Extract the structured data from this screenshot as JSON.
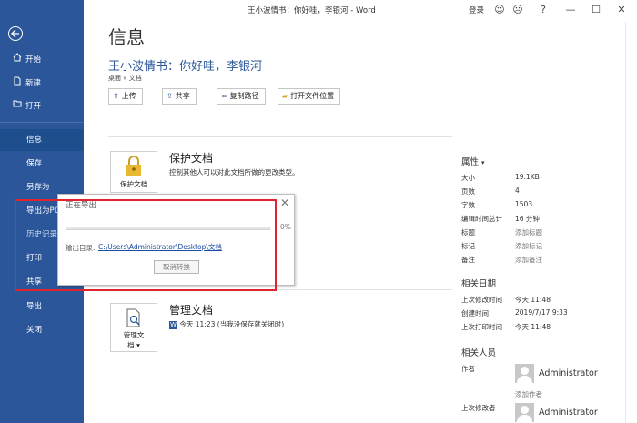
{
  "window": {
    "title": "王小波情书：你好哇，李银河  -  Word",
    "login": "登录",
    "icons": [
      "smile-icon",
      "frown-icon",
      "help-icon",
      "minimize-icon",
      "maximize-icon",
      "close-icon"
    ]
  },
  "sidebar": {
    "items": [
      {
        "label": "开始",
        "icon": "home-icon"
      },
      {
        "label": "新建",
        "icon": "new-doc-icon"
      },
      {
        "label": "打开",
        "icon": "open-folder-icon"
      },
      {
        "label": "信息"
      },
      {
        "label": "保存"
      },
      {
        "label": "另存为"
      },
      {
        "label": "导出为PDF"
      },
      {
        "label": "历史记录"
      },
      {
        "label": "打印"
      },
      {
        "label": "共享"
      },
      {
        "label": "导出"
      },
      {
        "label": "关闭"
      }
    ],
    "active": "信息",
    "accent": "#2b579a"
  },
  "main": {
    "page_title": "信息",
    "doc_heading": "王小波情书：你好哇，李银河",
    "breadcrumb": "桌面 » 文档",
    "buttons": [
      {
        "label": "上传",
        "icon": "upload-icon"
      },
      {
        "label": "共享",
        "icon": "share-icon"
      },
      {
        "label": "复制路径",
        "icon": "link-icon"
      },
      {
        "label": "打开文件位置",
        "icon": "folder-icon"
      }
    ],
    "protect": {
      "title": "保护文档",
      "desc": "控制其他人可以对此文档所做的更改类型。",
      "button_label": "保护文档"
    },
    "manage": {
      "title": "管理文档",
      "desc": "今天 11:23 (当我没保存就关闭时)",
      "button_line1": "管理文",
      "button_line2": "档"
    }
  },
  "properties": {
    "header": "属性",
    "rows": [
      {
        "label": "大小",
        "value": "19.1KB"
      },
      {
        "label": "页数",
        "value": "4"
      },
      {
        "label": "字数",
        "value": "1503"
      },
      {
        "label": "编辑时间总计",
        "value": "16 分钟"
      },
      {
        "label": "标题",
        "value": "添加标题"
      },
      {
        "label": "标记",
        "value": "添加标记"
      },
      {
        "label": "备注",
        "value": "添加备注"
      }
    ],
    "dates_header": "相关日期",
    "dates": [
      {
        "label": "上次修改时间",
        "value": "今天 11:48"
      },
      {
        "label": "创建时间",
        "value": "2019/7/17 9:33"
      },
      {
        "label": "上次打印时间",
        "value": "今天 11:48"
      }
    ],
    "people_header": "相关人员",
    "author_label": "作者",
    "author_name": "Administrator",
    "add_author": "添加作者",
    "last_modified_by_label": "上次修改者",
    "last_modified_by_name": "Administrator"
  },
  "dialog": {
    "title": "正在导出",
    "percent": "0%",
    "progress": 0,
    "output_label": "输出目录:",
    "output_path": "C:\\Users\\Administrator\\Desktop\\文档",
    "cancel": "取消转换",
    "highlight_color": "#e0232c"
  }
}
